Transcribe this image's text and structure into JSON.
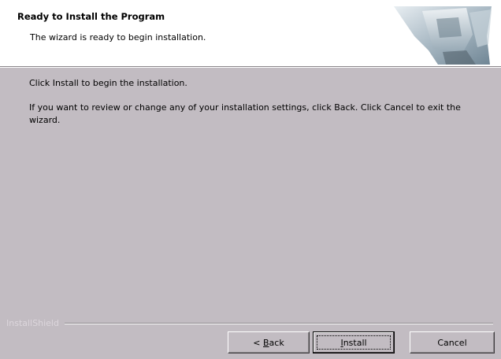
{
  "header": {
    "title": "Ready to Install the Program",
    "subtitle": "The wizard is ready to begin installation."
  },
  "body": {
    "line1": "Click Install to begin the installation.",
    "line2": "If you want to review or change any of your installation settings, click Back. Click Cancel to exit the wizard."
  },
  "footer": {
    "brand": "InstallShield",
    "buttons": {
      "back_prefix": "< ",
      "back_mnemonic": "B",
      "back_rest": "ack",
      "install_mnemonic": "I",
      "install_rest": "nstall",
      "cancel": "Cancel"
    }
  },
  "colors": {
    "dialog_bg": "#c2bcc2",
    "header_bg": "#ffffff"
  },
  "icons": {
    "header_graphic": "computer-monitor-graphic"
  }
}
